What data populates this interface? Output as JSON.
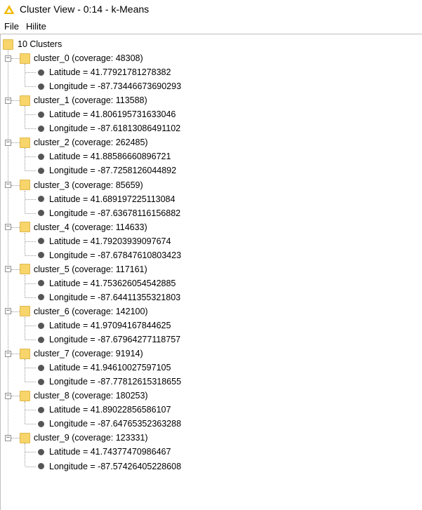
{
  "window": {
    "title": "Cluster View - 0:14 - k-Means",
    "app_icon": "knime-triangle-icon",
    "accent": "#f2b900"
  },
  "menu": {
    "file": "File",
    "hilite": "Hilite"
  },
  "tree": {
    "root_label": "10 Clusters",
    "clusters": [
      {
        "name": "cluster_0 (coverage: 48308)",
        "lat": "Latitude = 41.77921781278382",
        "lon": "Longitude = -87.73446673690293"
      },
      {
        "name": "cluster_1 (coverage: 113588)",
        "lat": "Latitude = 41.806195731633046",
        "lon": "Longitude = -87.61813086491102"
      },
      {
        "name": "cluster_2 (coverage: 262485)",
        "lat": "Latitude = 41.88586660896721",
        "lon": "Longitude = -87.7258126044892"
      },
      {
        "name": "cluster_3 (coverage: 85659)",
        "lat": "Latitude = 41.689197225113084",
        "lon": "Longitude = -87.63678116156882"
      },
      {
        "name": "cluster_4 (coverage: 114633)",
        "lat": "Latitude = 41.79203939097674",
        "lon": "Longitude = -87.67847610803423"
      },
      {
        "name": "cluster_5 (coverage: 117161)",
        "lat": "Latitude = 41.753626054542885",
        "lon": "Longitude = -87.64411355321803"
      },
      {
        "name": "cluster_6 (coverage: 142100)",
        "lat": "Latitude = 41.97094167844625",
        "lon": "Longitude = -87.67964277118757"
      },
      {
        "name": "cluster_7 (coverage: 91914)",
        "lat": "Latitude = 41.94610027597105",
        "lon": "Longitude = -87.77812615318655"
      },
      {
        "name": "cluster_8 (coverage: 180253)",
        "lat": "Latitude = 41.89022856586107",
        "lon": "Longitude = -87.64765352363288"
      },
      {
        "name": "cluster_9 (coverage: 123331)",
        "lat": "Latitude = 41.74377470986467",
        "lon": "Longitude = -87.57426405228608"
      }
    ]
  }
}
